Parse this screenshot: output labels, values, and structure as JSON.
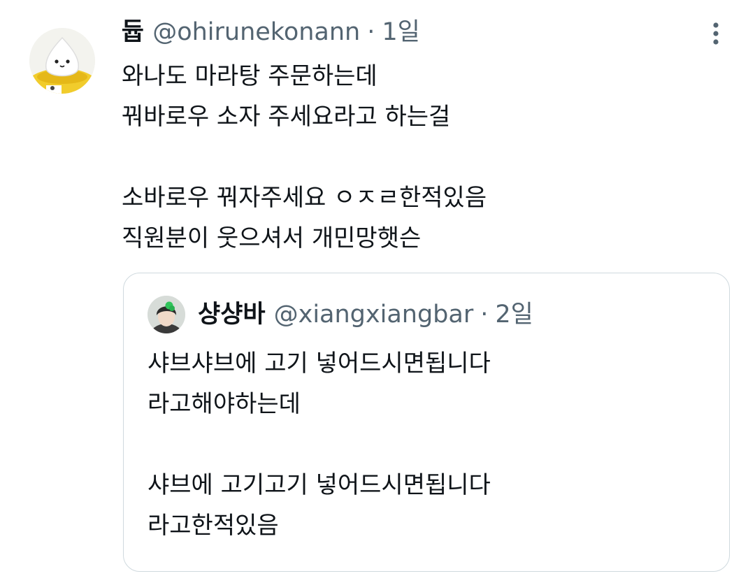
{
  "tweet": {
    "author_name": "듑",
    "handle": "@ohirunekonann",
    "separator": "·",
    "time": "1일",
    "lines": [
      "와나도 마라탕 주문하는데",
      "꿔바로우 소자 주세요라고 하는걸",
      "",
      "소바로우 꿔자주세요 ㅇㅈㄹ한적있음",
      "직원분이 웃으셔서 개민망햇슨"
    ],
    "more_icon": "more-vertical-icon",
    "avatar_icon": "mascot-avatar"
  },
  "quote": {
    "author_name": "샹샹바",
    "handle": "@xiangxiangbar",
    "separator": "·",
    "time": "2일",
    "lines": [
      "샤브샤브에 고기 넣어드시면됩니다",
      "라고해야하는데",
      "",
      "샤브에 고기고기 넣어드시면됩니다",
      "라고한적있음"
    ],
    "avatar_icon": "profile-photo-avatar"
  },
  "colors": {
    "text_primary": "#0f1419",
    "text_secondary": "#536471",
    "border": "#cfd9de",
    "background": "#ffffff"
  }
}
